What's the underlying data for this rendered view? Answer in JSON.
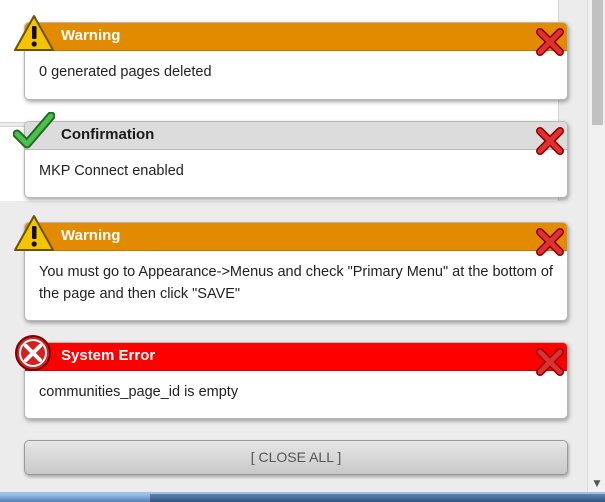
{
  "notices": [
    {
      "type": "warning",
      "title": "Warning",
      "message": "0 generated pages deleted",
      "icon": "warning-icon"
    },
    {
      "type": "confirmation",
      "title": "Confirmation",
      "message": "MKP Connect enabled",
      "icon": "checkmark-icon"
    },
    {
      "type": "warning",
      "title": "Warning",
      "message": "You must go to Appearance->Menus and check \"Primary Menu\" at the bottom of the page and then click \"SAVE\"",
      "icon": "warning-icon"
    },
    {
      "type": "error",
      "title": "System Error",
      "message": "communities_page_id is empty",
      "icon": "error-icon"
    }
  ],
  "close_all_label": "[ CLOSE ALL ]",
  "colors": {
    "warning": "#e38b00",
    "confirmation": "#dcdcdc",
    "error": "#ff0000"
  }
}
